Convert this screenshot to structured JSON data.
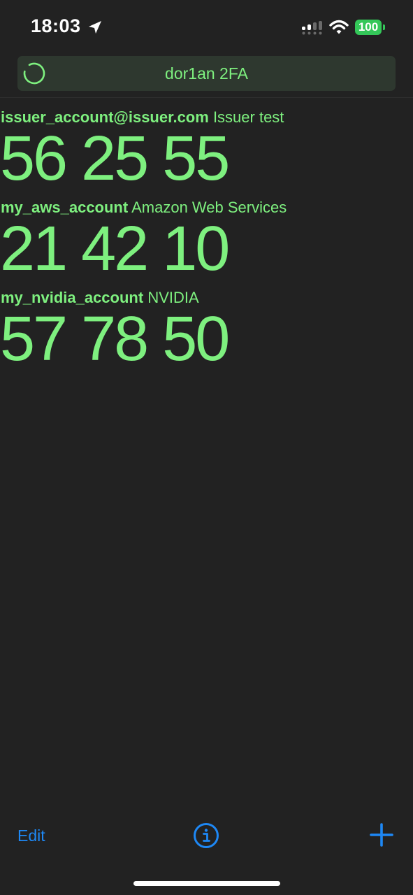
{
  "status_bar": {
    "time": "18:03",
    "battery_level": "100",
    "icons": [
      "location-arrow-icon",
      "cellular-signal-icon",
      "wifi-icon",
      "battery-icon"
    ]
  },
  "header": {
    "title": "dor1an 2FA",
    "refresh_indicator": "circular-progress-icon"
  },
  "accounts": [
    {
      "name": "issuer_account@issuer.com",
      "issuer": "Issuer test",
      "code": "56 25 55"
    },
    {
      "name": "my_aws_account",
      "issuer": "Amazon Web Services",
      "code": "21 42 10"
    },
    {
      "name": "my_nvidia_account",
      "issuer": "NVIDIA",
      "code": "57 78 50"
    }
  ],
  "toolbar": {
    "edit_label": "Edit",
    "info_icon": "info-circle-icon",
    "add_icon": "plus-icon"
  },
  "colors": {
    "background": "#222222",
    "accent_green": "#7ef07f",
    "header_bg": "#2e382f",
    "link_blue": "#1e88f5",
    "battery_green": "#34c759"
  }
}
